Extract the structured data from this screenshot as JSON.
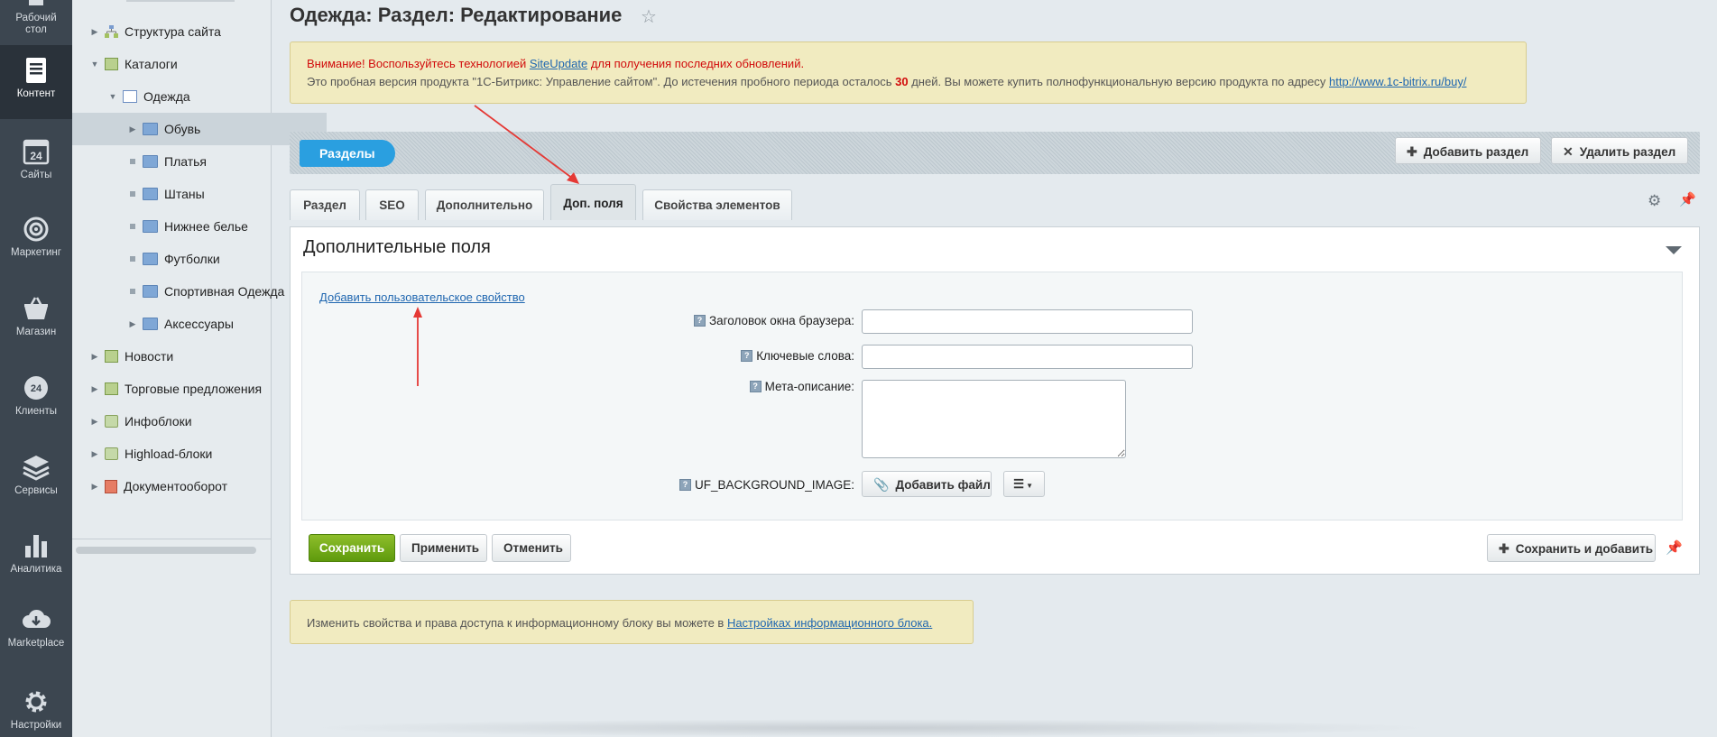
{
  "leftnav": {
    "items": [
      {
        "label": "Рабочий стол",
        "icon": "desktop-icon"
      },
      {
        "label": "Контент",
        "icon": "content-icon"
      },
      {
        "label": "Сайты",
        "icon": "sites-icon",
        "badge": "24"
      },
      {
        "label": "Маркетинг",
        "icon": "target-icon"
      },
      {
        "label": "Магазин",
        "icon": "basket-icon"
      },
      {
        "label": "Клиенты",
        "icon": "clients-icon",
        "badge": "24"
      },
      {
        "label": "Сервисы",
        "icon": "layers-icon"
      },
      {
        "label": "Аналитика",
        "icon": "analytics-icon"
      },
      {
        "label": "Marketplace",
        "icon": "cloud-download-icon"
      },
      {
        "label": "Настройки",
        "icon": "gear-icon"
      }
    ]
  },
  "tree": {
    "items": [
      {
        "label": "Структура сайта"
      },
      {
        "label": "Каталоги"
      },
      {
        "label": "Одежда"
      },
      {
        "label": "Обувь"
      },
      {
        "label": "Платья"
      },
      {
        "label": "Штаны"
      },
      {
        "label": "Нижнее белье"
      },
      {
        "label": "Футболки"
      },
      {
        "label": "Спортивная Одежда"
      },
      {
        "label": "Аксессуары"
      },
      {
        "label": "Новости"
      },
      {
        "label": "Торговые предложения"
      },
      {
        "label": "Инфоблоки"
      },
      {
        "label": "Highload-блоки"
      },
      {
        "label": "Документооборот"
      }
    ]
  },
  "header": {
    "title": "Одежда: Раздел: Редактирование"
  },
  "notice": {
    "l1_pre": "Внимание! Воспользуйтесь технологией ",
    "l1_link": "SiteUpdate",
    "l1_post": " для получения последних обновлений.",
    "l2_pre": "Это пробная версия продукта \"1С-Битрикс: Управление сайтом\". До истечения пробного периода осталось ",
    "l2_days": "30",
    "l2_mid": " дней. Вы можете купить полнофункциональную версию продукта по адресу ",
    "l2_link": "http://www.1c-bitrix.ru/buy/"
  },
  "toolbar": {
    "sections_label": "Разделы",
    "add_section": "Добавить раздел",
    "delete_section": "Удалить раздел"
  },
  "tabs": [
    {
      "label": "Раздел"
    },
    {
      "label": "SEO"
    },
    {
      "label": "Дополнительно"
    },
    {
      "label": "Доп. поля",
      "active": true
    },
    {
      "label": "Свойства элементов"
    }
  ],
  "panel": {
    "title": "Дополнительные поля",
    "add_prop_link": "Добавить пользовательское свойство",
    "fields": {
      "browser_title": {
        "label": "Заголовок окна браузера:",
        "value": ""
      },
      "keywords": {
        "label": "Ключевые слова:",
        "value": ""
      },
      "meta_desc": {
        "label": "Мета-описание:",
        "value": ""
      },
      "bg_image": {
        "label": "UF_BACKGROUND_IMAGE:",
        "add_file": "Добавить файл"
      }
    }
  },
  "actions": {
    "save": "Сохранить",
    "apply": "Применить",
    "cancel": "Отменить",
    "save_add": "Сохранить и добавить"
  },
  "info": {
    "text": "Изменить свойства и права доступа к информационному блоку вы можете в ",
    "link": "Настройках информационного блока."
  },
  "colors": {
    "nav_bg": "#3c4650",
    "accent_blue": "#2a9fe0",
    "save_green": "#6aa514",
    "notice_bg": "#f1ebc0",
    "link": "#2067b0",
    "warning_red": "#d10b0b",
    "annotation_red": "#e53935"
  }
}
